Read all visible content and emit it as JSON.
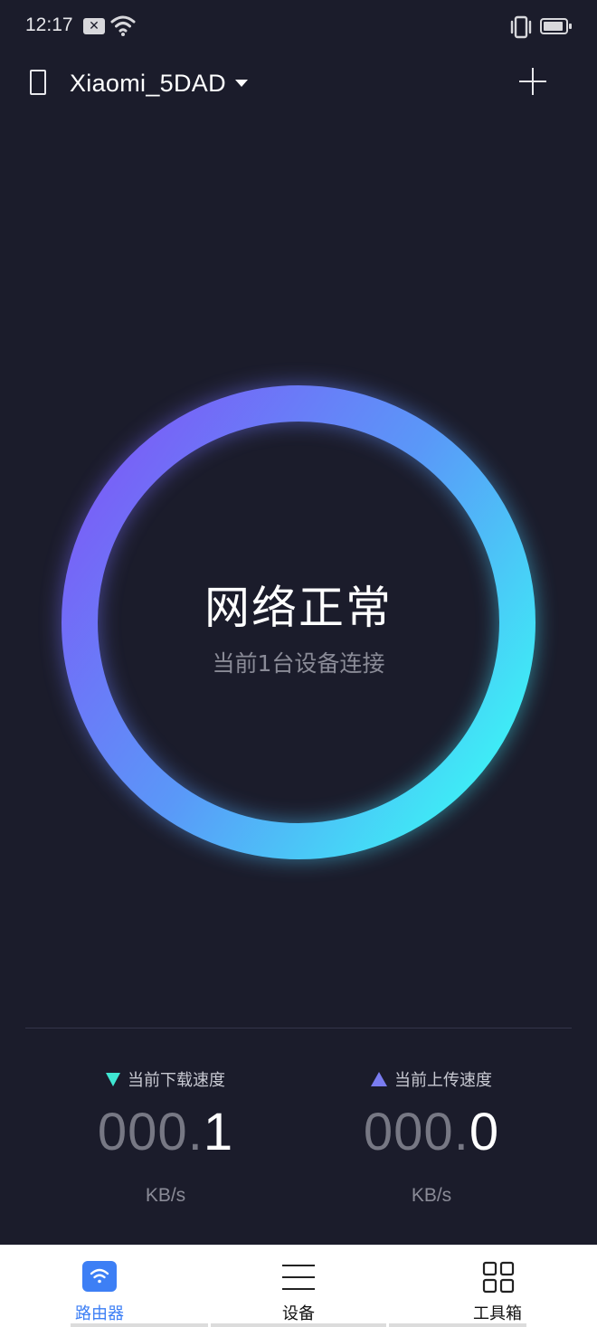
{
  "status_bar": {
    "time": "12:17",
    "icons": [
      "notification-icon",
      "wifi-icon",
      "vibrate-icon",
      "battery-icon"
    ]
  },
  "header": {
    "router_name": "Xiaomi_5DAD",
    "icons": [
      "device-icon",
      "dropdown-icon",
      "add-icon"
    ]
  },
  "network_status": {
    "title": "网络正常",
    "subtitle": "当前1台设备连接",
    "ring_colors": [
      "#7b5cf7",
      "#3bf6f6"
    ]
  },
  "speeds": {
    "download": {
      "label": "当前下载速度",
      "value_dim": "000.",
      "value_bright": "1",
      "unit": "KB/s",
      "color": "#3fe6d2"
    },
    "upload": {
      "label": "当前上传速度",
      "value_dim": "000.",
      "value_bright": "0",
      "unit": "KB/s",
      "color": "#7a7cf0"
    }
  },
  "bottom_nav": {
    "items": [
      {
        "label": "路由器",
        "icon": "router-wifi-icon",
        "active": true
      },
      {
        "label": "设备",
        "icon": "menu-list-icon",
        "active": false
      },
      {
        "label": "工具箱",
        "icon": "grid-icon",
        "active": false
      }
    ],
    "active_color": "#3d7ff5"
  }
}
